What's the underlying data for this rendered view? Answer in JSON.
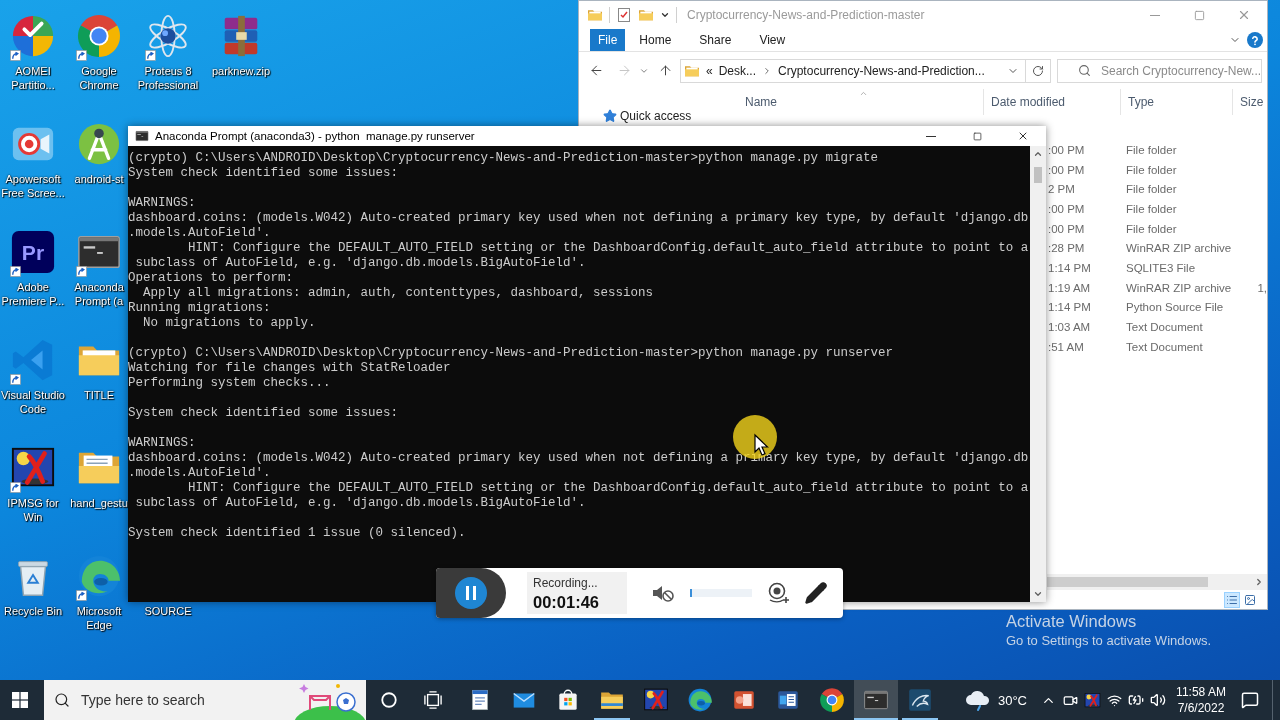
{
  "desktop": {
    "columns": [
      [
        {
          "label": "AOMEI Partitio...",
          "kind": "aomei",
          "shortcut": true
        },
        {
          "label": "Apowersoft Free Scree...",
          "kind": "apowersoft",
          "shortcut": false
        },
        {
          "label": "Adobe Premiere P...",
          "kind": "premiere",
          "logo_text": "Pr",
          "shortcut": true
        },
        {
          "label": "Visual Studio Code",
          "kind": "vscode",
          "shortcut": true
        },
        {
          "label": "IPMSG for Win",
          "kind": "ipmsg",
          "shortcut": true
        },
        {
          "label": "Recycle Bin",
          "kind": "recycle_bin",
          "shortcut": false
        }
      ],
      [
        {
          "label": "Google Chrome",
          "kind": "chrome",
          "shortcut": true
        },
        {
          "label": "android-st",
          "kind": "android_studio",
          "shortcut": false
        },
        {
          "label": "Anaconda Prompt (a",
          "kind": "console",
          "shortcut": true
        },
        {
          "label": "TITLE",
          "kind": "folder",
          "shortcut": false
        },
        {
          "label": "hand_gestu",
          "kind": "folder_docs",
          "shortcut": false
        },
        {
          "label": "Microsoft Edge",
          "kind": "edge",
          "shortcut": true
        }
      ],
      [
        {
          "label": "Proteus 8 Professional",
          "kind": "proteus",
          "shortcut": true
        },
        {
          "label": "SOURCE"
        }
      ],
      [
        {
          "label": "parknew.zip",
          "kind": "archive",
          "shortcut": false
        }
      ]
    ]
  },
  "explorer": {
    "title": "Cryptocurrency-News-and-Prediction-master",
    "ribbon": [
      {
        "label": "File",
        "kind": "menu"
      },
      {
        "label": "Home",
        "kind": "tab"
      },
      {
        "label": "Share",
        "kind": "tab"
      },
      {
        "label": "View",
        "kind": "tab"
      }
    ],
    "nav_buttons": [
      {
        "kind": "back",
        "disabled": false
      },
      {
        "kind": "forward",
        "disabled": true
      },
      {
        "kind": "recent",
        "disabled": false
      },
      {
        "kind": "up",
        "disabled": false
      }
    ],
    "address": {
      "overflow": "«",
      "crumbs": [
        "Desk...",
        "Cryptocurrency-News-and-Prediction..."
      ]
    },
    "search": {
      "placeholder": "Search Cryptocurrency-New..."
    },
    "columns": [
      "Name",
      "Date modified",
      "Type",
      "Size"
    ],
    "nav_pane": [
      "Quick access"
    ],
    "rows": [
      {
        "date": ":00 PM",
        "type": "File folder"
      },
      {
        "date": ":00 PM",
        "type": "File folder"
      },
      {
        "date": "2 PM",
        "type": "File folder"
      },
      {
        "date": ":00 PM",
        "type": "File folder"
      },
      {
        "date": ":00 PM",
        "type": "File folder"
      },
      {
        "date": ":28 PM",
        "type": "WinRAR ZIP archive"
      },
      {
        "date": "1:14 PM",
        "type": "SQLITE3 File"
      },
      {
        "date": "1:19 AM",
        "type": "WinRAR ZIP archive",
        "size": "1,"
      },
      {
        "date": "1:14 PM",
        "type": "Python Source File"
      },
      {
        "date": "1:03 AM",
        "type": "Text Document"
      },
      {
        "date": ":51 AM",
        "type": "Text Document"
      }
    ],
    "views": [
      {
        "kind": "details",
        "selected": true
      },
      {
        "kind": "large_icons",
        "selected": false
      }
    ]
  },
  "terminal": {
    "title": "Anaconda Prompt (anaconda3) - python  manage.py runserver",
    "blocks": [
      [
        "(crypto) C:\\Users\\ANDROID\\Desktop\\Cryptocurrency-News-and-Prediction-master>python manage.py migrate",
        "System check identified some issues:"
      ],
      [
        "WARNINGS:",
        "dashboard.coins: (models.W042) Auto-created primary key used when not defining a primary key type, by default 'django.db",
        ".models.AutoField'.",
        "        HINT: Configure the DEFAULT_AUTO_FIELD setting or the DashboardConfig.default_auto_field attribute to point to a",
        " subclass of AutoField, e.g. 'django.db.models.BigAutoField'.",
        "Operations to perform:",
        "  Apply all migrations: admin, auth, contenttypes, dashboard, sessions",
        "Running migrations:",
        "  No migrations to apply."
      ],
      [
        "(crypto) C:\\Users\\ANDROID\\Desktop\\Cryptocurrency-News-and-Prediction-master>python manage.py runserver",
        "Watching for file changes with StatReloader",
        "Performing system checks..."
      ],
      [
        "System check identified some issues:"
      ],
      [
        "WARNINGS:",
        "dashboard.coins: (models.W042) Auto-created primary key used when not defining a primary key type, by default 'django.db",
        ".models.AutoField'.",
        "        HINT: Configure the DEFAULT_AUTO_FIELD setting or the DashboardConfig.default_auto_field attribute to point to a",
        " subclass of AutoField, e.g. 'django.db.models.BigAutoField'."
      ],
      [
        "System check identified 1 issue (0 silenced)."
      ]
    ]
  },
  "recorder": {
    "status": "Recording...",
    "time": "00:01:46",
    "mic_muted": true,
    "level": 0.03
  },
  "activation": {
    "title": "Activate Windows",
    "message": "Go to Settings to activate Windows."
  },
  "taskbar": {
    "search": {
      "placeholder": "Type here to search"
    },
    "apps": [
      {
        "kind": "wordpad",
        "selected": false,
        "running": false
      },
      {
        "kind": "mail",
        "selected": false,
        "running": false
      },
      {
        "kind": "store",
        "selected": false,
        "running": false
      },
      {
        "kind": "explorer",
        "selected": false,
        "running": true
      },
      {
        "kind": "ipmsg",
        "selected": false,
        "running": false
      },
      {
        "kind": "edge",
        "selected": false,
        "running": false
      },
      {
        "kind": "powerpoint",
        "selected": false,
        "running": false
      },
      {
        "kind": "word",
        "selected": false,
        "running": false
      },
      {
        "kind": "chrome",
        "selected": false,
        "running": false
      },
      {
        "kind": "console",
        "selected": true,
        "running": true
      },
      {
        "kind": "dolphin",
        "selected": false,
        "running": true
      }
    ],
    "weather": "30°C",
    "clock": {
      "time": "11:58 AM",
      "date": "7/6/2022"
    }
  }
}
